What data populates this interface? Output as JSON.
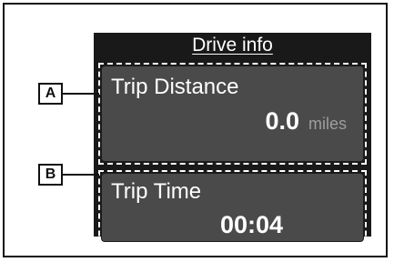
{
  "screen": {
    "title": "Drive info",
    "items": [
      {
        "label": "Trip Distance",
        "value": "0.0",
        "unit": "miles"
      },
      {
        "label": "Trip Time",
        "value": "00:04"
      }
    ]
  },
  "callouts": [
    "A",
    "B"
  ],
  "colors": {
    "screen_background": "#191919",
    "panel_background": "#4a4a4a",
    "text": "#ffffff",
    "unit_text": "#9d9d9d",
    "outline": "#111111"
  }
}
